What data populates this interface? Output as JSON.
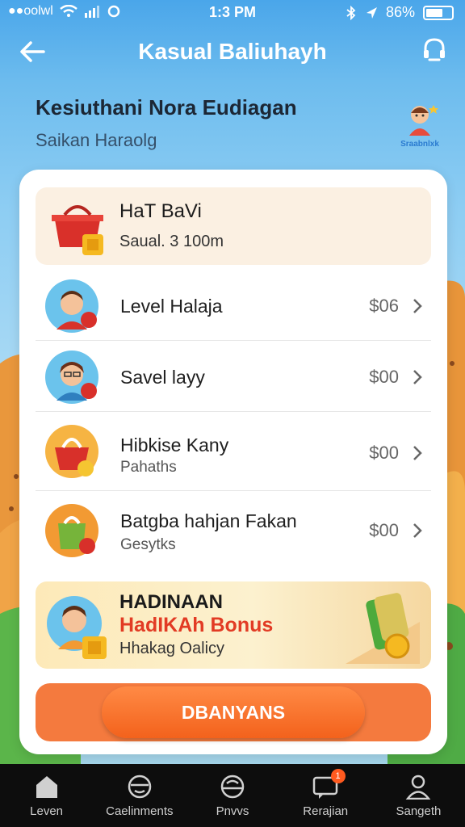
{
  "status_bar": {
    "carrier": "●●oolwl",
    "time": "1:3 PM",
    "battery": "86%"
  },
  "header": {
    "title": "Kasual Baliuhayh"
  },
  "intro": {
    "title": "Kesiuthani Nora Eudiagan",
    "subtitle": "Saikan Haraolg",
    "mascot_caption": "Sraabnlxk"
  },
  "top_item": {
    "title": "HaT BaVi",
    "subtitle": "Saual. 3 100m"
  },
  "items": [
    {
      "name": "Level Halaja",
      "sub": "",
      "price": "$06"
    },
    {
      "name": "Savel layy",
      "sub": "",
      "price": "$00"
    },
    {
      "name": "Hibkise Kany",
      "sub": "Pahaths",
      "price": "$00"
    },
    {
      "name": "Batgba hahjan Fakan",
      "sub": "Gesytks",
      "price": "$00"
    }
  ],
  "bonus": {
    "line1": "HADINAAN",
    "line2": "HadIKAh Bonus",
    "line3": "Hhakag Oalicy"
  },
  "cta": {
    "label": "DBANYANS"
  },
  "tabs": [
    {
      "label": "Leven",
      "icon": "home-icon"
    },
    {
      "label": "Caelinments",
      "icon": "face-icon"
    },
    {
      "label": "Pnvvs",
      "icon": "game-icon"
    },
    {
      "label": "Rerajian",
      "icon": "chat-icon",
      "badge": "1"
    },
    {
      "label": "Sangeth",
      "icon": "person-icon"
    }
  ]
}
